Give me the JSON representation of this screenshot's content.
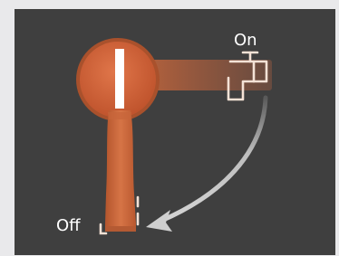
{
  "labels": {
    "on": "On",
    "off": "Off"
  },
  "icons": {
    "on_state": "faucet-on-icon",
    "off_state": "faucet-off-icon",
    "direction": "curved-arrow-icon"
  },
  "colors": {
    "panel_background": "#3f3f3f",
    "page_background": "#e9e9eb",
    "handle_orange": "#c8653a",
    "knob_face": "#cf5a34",
    "arrow": "#c4c4c4",
    "label": "#ffffff"
  }
}
